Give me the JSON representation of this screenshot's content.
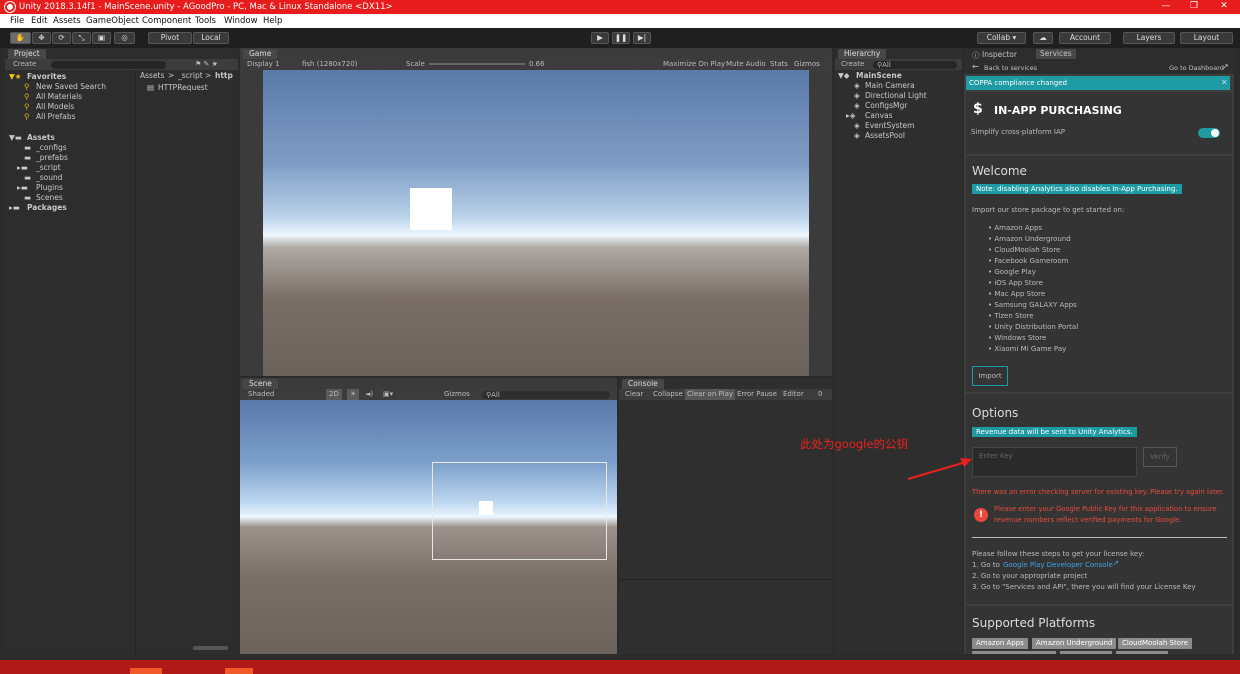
{
  "titlebar": {
    "title": "Unity 2018.3.14f1 - MainScene.unity - AGoodPro - PC, Mac & Linux Standalone <DX11>",
    "minimize": "—",
    "maximize": "❐",
    "close": "✕"
  },
  "menu": [
    "File",
    "Edit",
    "Assets",
    "GameObject",
    "Component",
    "Tools",
    "Window",
    "Help"
  ],
  "toolbar": {
    "pivot": "Pivot",
    "local": "Local",
    "collab": "Collab ▾",
    "account": "Account",
    "layers": "Layers",
    "layout": "Layout"
  },
  "project": {
    "tab": "Project",
    "create": "Create",
    "breadcrumb": [
      "Assets",
      ">",
      "_script",
      ">",
      "http"
    ],
    "favorites_label": "Favorites",
    "favorites": [
      "New Saved Search",
      "All Materials",
      "All Models",
      "All Prefabs"
    ],
    "assets_label": "Assets",
    "assets": [
      "_configs",
      "_prefabs",
      "_script",
      "_sound",
      "Plugins",
      "Scenes"
    ],
    "packages_label": "Packages",
    "files": [
      "HTTPRequest"
    ]
  },
  "game": {
    "tab": "Game",
    "display": "Display 1",
    "resolution": "fish (1280x720)",
    "scale_label": "Scale",
    "scale_value": "0.66",
    "options": [
      "Maximize On Play",
      "Mute Audio",
      "Stats",
      "Gizmos"
    ]
  },
  "scene": {
    "tab": "Scene",
    "shading": "Shaded",
    "mode_2d": "2D",
    "gizmos": "Gizmos",
    "search": "All"
  },
  "console": {
    "tab": "Console",
    "buttons": [
      "Clear",
      "Collapse",
      "Clear on Play",
      "Error Pause",
      "Editor"
    ],
    "count": "0"
  },
  "hierarchy": {
    "tab": "Hierarchy",
    "create": "Create",
    "search": "All",
    "scene": "MainScene",
    "items": [
      "Main Camera",
      "Directional Light",
      "ConfigsMgr",
      "Canvas",
      "EventSystem",
      "AssetsPool"
    ]
  },
  "inspector_tabs": [
    "Inspector",
    "Services"
  ],
  "services": {
    "back": "Back to services",
    "dashboard": "Go to Dashboard",
    "coppa": "COPPA compliance changed",
    "iap_title": "IN-APP PURCHASING",
    "iap_sub": "Simplify cross-platform IAP",
    "welcome_title": "Welcome",
    "welcome_note": "Note: disabling Analytics also disables In-App Purchasing.",
    "import_text": "Import our store package to get started on:",
    "stores": [
      "Amazon Apps",
      "Amazon Underground",
      "CloudMoolah Store",
      "Facebook Gameroom",
      "Google Play",
      "iOS App Store",
      "Mac App Store",
      "Samsung GALAXY Apps",
      "Tizen Store",
      "Unity Distribution Portal",
      "Windows Store",
      "Xiaomi Mi Game Pay"
    ],
    "import_btn": "Import",
    "options_title": "Options",
    "options_note": "Revenue data will be sent to Unity Analytics.",
    "key_placeholder": "Enter Key",
    "verify_btn": "Verify",
    "error_line": "There was an error checking server for existing key. Please try again later.",
    "error_msg": "Please enter your Google Public Key for this application to ensure revenue numbers reflect verified payments for Google.",
    "steps_intro": "Please follow these steps to get your license key:",
    "step1_prefix": "1.  Go to ",
    "step1_link": "Google Play Developer Console",
    "step2": "2.  Go to your appropriate project",
    "step3": "3.  Go to \"Services and API\", there you will find your License Key",
    "platforms_title": "Supported Platforms",
    "platforms": [
      "Amazon Apps",
      "Amazon Underground",
      "CloudMoolah Store"
    ]
  },
  "annotation": {
    "text": "此处为google的公钥",
    "color": "#e8211c"
  },
  "colors": {
    "titlebar": "#e81c1c",
    "accent": "#1e9aa3",
    "link": "#3fa4e8",
    "error": "#e84b3c"
  }
}
